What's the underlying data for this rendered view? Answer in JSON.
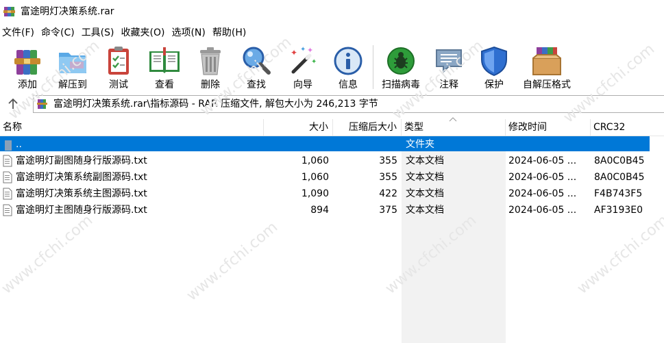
{
  "window": {
    "title": "富途明灯决策系统.rar"
  },
  "menu": [
    "文件(F)",
    "命令(C)",
    "工具(S)",
    "收藏夹(O)",
    "选项(N)",
    "帮助(H)"
  ],
  "toolbar": [
    {
      "label": "添加",
      "icon": "add-archive-icon"
    },
    {
      "label": "解压到",
      "icon": "extract-to-icon"
    },
    {
      "label": "测试",
      "icon": "test-clipboard-icon"
    },
    {
      "label": "查看",
      "icon": "view-book-icon"
    },
    {
      "label": "删除",
      "icon": "trash-icon"
    },
    {
      "label": "查找",
      "icon": "magnifier-icon"
    },
    {
      "label": "向导",
      "icon": "wizard-wand-icon"
    },
    {
      "label": "信息",
      "icon": "info-icon"
    },
    {
      "label": "扫描病毒",
      "icon": "virus-scan-icon"
    },
    {
      "label": "注释",
      "icon": "comment-icon"
    },
    {
      "label": "保护",
      "icon": "shield-icon"
    },
    {
      "label": "自解压格式",
      "icon": "sfx-box-icon"
    }
  ],
  "address": {
    "path": "富途明灯决策系统.rar\\指标源码 - RAR 压缩文件, 解包大小为 246,213 字节"
  },
  "columns": {
    "name": "名称",
    "size": "大小",
    "packed": "压缩后大小",
    "type": "类型",
    "modified": "修改时间",
    "crc": "CRC32"
  },
  "rows": [
    {
      "name": "..",
      "size": "",
      "packed": "",
      "type": "文件夹",
      "modified": "",
      "crc": "",
      "selected": true
    },
    {
      "name": "富途明灯副图随身行版源码.txt",
      "size": "1,060",
      "packed": "355",
      "type": "文本文档",
      "modified": "2024-06-05 ...",
      "crc": "8A0C0B45"
    },
    {
      "name": "富途明灯决策系统副图源码.txt",
      "size": "1,060",
      "packed": "355",
      "type": "文本文档",
      "modified": "2024-06-05 ...",
      "crc": "8A0C0B45"
    },
    {
      "name": "富途明灯决策系统主图源码.txt",
      "size": "1,090",
      "packed": "422",
      "type": "文本文档",
      "modified": "2024-06-05 ...",
      "crc": "F4B743F5"
    },
    {
      "name": "富途明灯主图随身行版源码.txt",
      "size": "894",
      "packed": "375",
      "type": "文本文档",
      "modified": "2024-06-05 ...",
      "crc": "AF3193E0"
    }
  ],
  "watermark": {
    "text": "www.cfchi.com",
    "color": "#e6e6e6"
  },
  "colors": {
    "selection": "#0078d7",
    "sorted_column": "#f2f2f2"
  }
}
